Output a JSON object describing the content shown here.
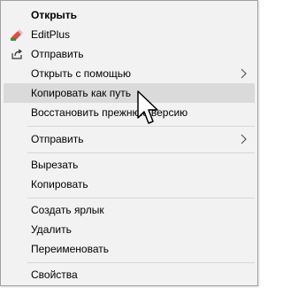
{
  "menu": {
    "items": [
      {
        "label": "Открыть",
        "icon": ""
      },
      {
        "label": "EditPlus",
        "icon": "editplus-icon"
      },
      {
        "label": "Отправить",
        "icon": "share-icon"
      },
      {
        "label": "Открыть с помощью"
      },
      {
        "label": "Копировать как путь"
      },
      {
        "label": "Восстановить прежнюю версию"
      },
      {
        "label": "Отправить"
      },
      {
        "label": "Вырезать"
      },
      {
        "label": "Копировать"
      },
      {
        "label": "Создать ярлык"
      },
      {
        "label": "Удалить"
      },
      {
        "label": "Переименовать"
      },
      {
        "label": "Свойства"
      }
    ],
    "highlighted_item": "Копировать как путь"
  },
  "colors": {
    "menu_background": "#f2f2f2",
    "highlight": "#dadada",
    "separator": "#d7d7d7",
    "border": "#a0a0a0"
  }
}
